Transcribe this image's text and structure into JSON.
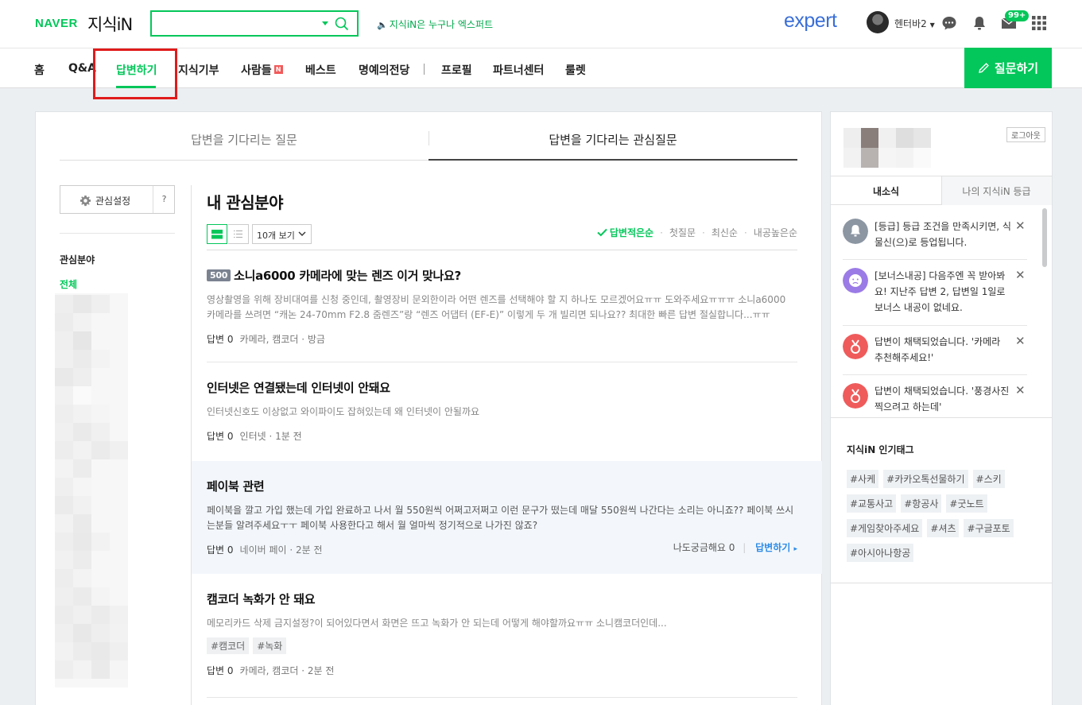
{
  "header": {
    "brand": "NAVER",
    "service": "지식iN",
    "search_value": "",
    "expert_promo": "지식iN은 누구나 엑스퍼트",
    "expert_logo": "expert",
    "user_name": "헨터바2",
    "mail_badge": "99+"
  },
  "nav": {
    "items": [
      "홈",
      "Q&A",
      "답변하기",
      "지식기부",
      "사람들",
      "베스트",
      "명예의전당",
      "프로필",
      "파트너센터",
      "룰렛"
    ],
    "new_badge": "N",
    "active_index": 2,
    "ask_button": "질문하기"
  },
  "main": {
    "tabs": [
      "답변을 기다리는 질문",
      "답변을 기다리는 관심질문"
    ],
    "selected_tab": 1,
    "settings_label": "관심설정",
    "help_label": "?",
    "favorites_title": "관심분야",
    "favorites_all": "전체",
    "section_title": "내 관심분야",
    "page_size": "10개 보기",
    "sort_options": [
      "답변적은순",
      "첫질문",
      "최신순",
      "내공높은순"
    ],
    "questions": [
      {
        "points": "500",
        "title": "소니a6000 카메라에 맞는 렌즈 이거 맞나요?",
        "body": "영상촬영을 위해 장비대여를 신청 중인데, 촬영장비 문외한이라 어떤 렌즈를 선택해야 할 지 하나도 모르겠어요ㅠㅠ 도와주세요ㅠㅠㅠ 소니a6000 카메라를 쓰려면 “캐논 24-70mm F2.8 줌렌즈”랑 “렌즈 어댑터 (EF-E)” 이렇게 두 개 빌리면 되나요?? 최대한 빠른 답변 절실합니다...ㅠㅠ",
        "answers": "답변 0",
        "meta": "카메라, 캠코더 · 방금"
      },
      {
        "points": "",
        "title": "인터넷은 연결됐는데 인터넷이 안돼요",
        "body": "인터넷신호도 이상없고 와이파이도 잡혀있는데 왜 인터넷이 안될까요",
        "answers": "답변 0",
        "meta": "인터넷 · 1분 전"
      },
      {
        "points": "",
        "title": "페이북 관련",
        "body": "페이북을 깔고 가입 했는데 가입 완료하고 나서 월 550원씩 어쩌고저쩌고 이런 문구가 떴는데 매달 550원씩 나간다는 소리는 아니죠?? 페이북 쓰시는분들 알려주세요ㅜㅜ 페이북 사용한다고 해서 월 얼마씩 정기적으로 나가진 않죠?",
        "answers": "답변 0",
        "meta": "네이버 페이 · 2분 전",
        "curious": "나도궁금해요 0",
        "answer_link": "답변하기"
      },
      {
        "points": "",
        "title": "캠코더 녹화가 안 돼요",
        "body": "메모리카드 삭제 금지설정?이 되어있다면서 화면은 뜨고 녹화가 안 되는데 어떻게 해야할까요ㅠㅠ 소니캠코더인데...",
        "tags": [
          "#캠코더",
          "#녹화"
        ],
        "answers": "답변 0",
        "meta": "카메라, 캠코더 · 2분 전"
      }
    ]
  },
  "right_panel": {
    "logout": "로그아웃",
    "tabs": [
      "내소식",
      "나의 지식iN 등급"
    ],
    "notices": [
      {
        "text": "[등급] 등급 조건을 만족시키면, 식물신(으)로 등업됩니다.",
        "color": "#8c96a3"
      },
      {
        "text": "[보너스내공] 다음주엔 꼭 받아봐요! 지난주 답변 2, 답변일 1일로 보너스 내공이 없네요.",
        "color": "#9b7be6"
      },
      {
        "text": "답변이 채택되었습니다. '카메라 추천해주세요!'",
        "color": "#ef5b5b"
      },
      {
        "text": "답변이 채택되었습니다. '풍경사진 찍으려고 하는데'",
        "color": "#ef5b5b"
      }
    ],
    "popular_title": "지식iN 인기태그",
    "popular_tags": [
      "#사케",
      "#카카오톡선물하기",
      "#스키",
      "#교통사고",
      "#항공사",
      "#굿노트",
      "#게임찾아주세요",
      "#셔츠",
      "#구글포토",
      "#아시아나항공"
    ]
  }
}
